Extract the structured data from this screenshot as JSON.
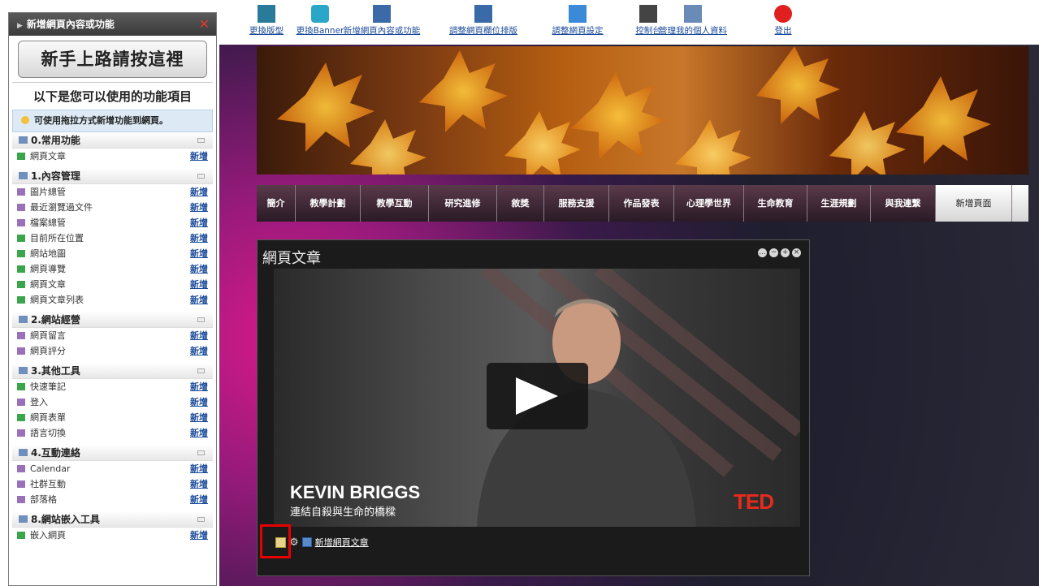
{
  "left_panel": {
    "title": "新增網頁內容或功能",
    "close": "✕",
    "newbie_button": "新手上路請按這裡",
    "available_heading": "以下是您可以使用的功能項目",
    "drag_tip": "可使用拖拉方式新增功能到網頁。",
    "add_label": "新增",
    "groups": [
      {
        "title": "0.常用功能",
        "items": [
          {
            "label": "網頁文章",
            "icon_color": "#3aa54a"
          }
        ]
      },
      {
        "title": "1.內容管理",
        "items": [
          {
            "label": "圖片總管",
            "icon_color": "#9a70b8"
          },
          {
            "label": "最近瀏覽過文件",
            "icon_color": "#9a70b8"
          },
          {
            "label": "檔案總管",
            "icon_color": "#9a70b8"
          },
          {
            "label": "目前所在位置",
            "icon_color": "#3aa54a"
          },
          {
            "label": "網站地圖",
            "icon_color": "#3aa54a"
          },
          {
            "label": "網頁導覽",
            "icon_color": "#3aa54a"
          },
          {
            "label": "網頁文章",
            "icon_color": "#3aa54a"
          },
          {
            "label": "網頁文章列表",
            "icon_color": "#3aa54a"
          }
        ]
      },
      {
        "title": "2.網站經營",
        "items": [
          {
            "label": "網頁留言",
            "icon_color": "#9a70b8"
          },
          {
            "label": "網頁評分",
            "icon_color": "#9a70b8"
          }
        ]
      },
      {
        "title": "3.其他工具",
        "items": [
          {
            "label": "快速筆記",
            "icon_color": "#3aa54a"
          },
          {
            "label": "登入",
            "icon_color": "#9a70b8"
          },
          {
            "label": "網頁表單",
            "icon_color": "#3aa54a"
          },
          {
            "label": "語言切換",
            "icon_color": "#9a70b8"
          }
        ]
      },
      {
        "title": "4.互動連絡",
        "items": [
          {
            "label": "Calendar",
            "icon_color": "#9a70b8"
          },
          {
            "label": "社群互動",
            "icon_color": "#9a70b8"
          },
          {
            "label": "部落格",
            "icon_color": "#9a70b8"
          }
        ]
      },
      {
        "title": "8.網站嵌入工具",
        "items": [
          {
            "label": "嵌入網頁",
            "icon_color": "#3aa54a"
          }
        ]
      }
    ]
  },
  "toolbar": [
    {
      "label": "更換版型",
      "icon": "layout-icon",
      "color": "#2a7a9a"
    },
    {
      "label": "更換Banner",
      "icon": "banner-icon",
      "color": "#2aa6c8"
    },
    {
      "label": "新增網頁內容或功能",
      "icon": "add-content-icon",
      "color": "#3a6aa8"
    },
    {
      "label": "調整網頁欄位排版",
      "icon": "columns-icon",
      "color": "#3a6aa8"
    },
    {
      "label": "調整網頁設定",
      "icon": "settings-brush-icon",
      "color": "#3a8ad8"
    },
    {
      "label": "控制台",
      "icon": "tools-icon",
      "color": "#444444"
    },
    {
      "label": "管理我的個人資料",
      "icon": "profile-card-icon",
      "color": "#6a8ab8"
    },
    {
      "label": "登出",
      "icon": "power-icon",
      "color": "#e02020"
    }
  ],
  "nav": [
    "簡介",
    "教學計劃",
    "教學互動",
    "研究進修",
    "敘獎",
    "服務支援",
    "作品發表",
    "心理學世界",
    "生命教育",
    "生涯規劃",
    "與我連繫",
    "新增頁面"
  ],
  "widget": {
    "title": "網頁文章",
    "buttons": [
      "…",
      "−",
      "+",
      "×"
    ],
    "video": {
      "speaker": "KEVIN BRIGGS",
      "subtitle": "連結自殺與生命的橋樑",
      "brand": "TED"
    },
    "footer_link": "新增網頁文章"
  },
  "colors": {
    "highlight": "#e60000",
    "link": "#1a4a9a",
    "ted_red": "#e62b1e"
  }
}
